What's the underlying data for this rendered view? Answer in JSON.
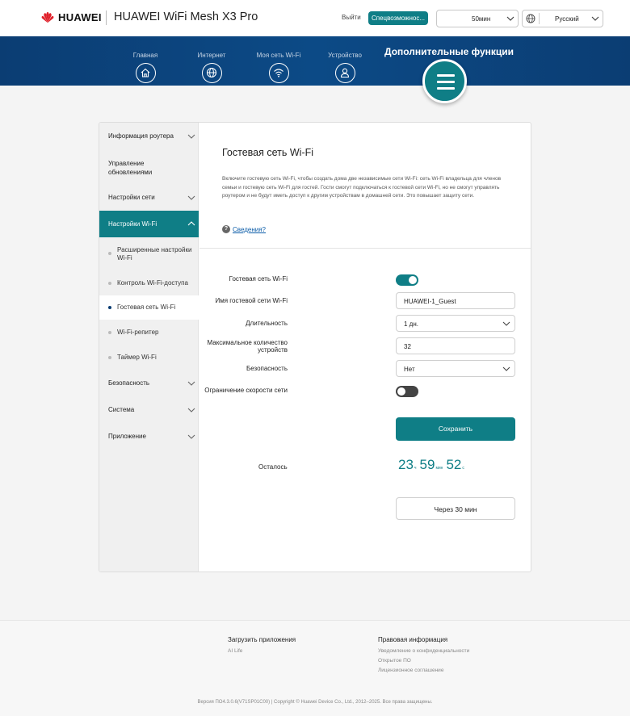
{
  "header": {
    "brand": "HUAWEI",
    "product": "HUAWEI WiFi Mesh X3 Pro",
    "logout": "Выйти",
    "special": "Спецвозможнос...",
    "timer_select": "50мин",
    "language_select": "Русский"
  },
  "nav": {
    "items": [
      {
        "label": "Главная",
        "icon": "home-icon"
      },
      {
        "label": "Интернет",
        "icon": "globe-icon"
      },
      {
        "label": "Моя сеть Wi-Fi",
        "icon": "wifi-icon"
      },
      {
        "label": "Устройство",
        "icon": "user-icon"
      }
    ],
    "extra": "Дополнительные функции"
  },
  "sidebar": {
    "items": [
      {
        "label": "Информация роутера"
      },
      {
        "label_line1": "Управление",
        "label_line2": "обновлениями"
      },
      {
        "label": "Настройки сети"
      },
      {
        "label": "Настройки Wi-Fi"
      },
      {
        "label": "Безопасность"
      },
      {
        "label": "Система"
      },
      {
        "label": "Приложение"
      }
    ],
    "sub_items": [
      {
        "label_line1": "Расширенные настройки",
        "label_line2": "Wi-Fi"
      },
      {
        "label": "Контроль Wi-Fi-доступа"
      },
      {
        "label": "Гостевая сеть Wi-Fi"
      },
      {
        "label": "Wi-Fi-репитер"
      },
      {
        "label": "Таймер Wi-Fi"
      }
    ]
  },
  "content": {
    "title": "Гостевая сеть Wi-Fi",
    "description": "Включите гостевую сеть Wi-Fi, чтобы создать дома две независимые сети Wi-Fi: сеть Wi-Fi владельца для членов семьи и гостевую сеть Wi-Fi для гостей. Гости смогут подключаться к гостевой сети Wi-Fi, но не смогут управлять роутером и не будут иметь доступ к другим устройствам в домашней сети. Это повышает защиту сети.",
    "help_mark": "?",
    "help": "Сведения?",
    "form": {
      "guest_wifi_label": "Гостевая сеть Wi-Fi",
      "guest_wifi_on": true,
      "ssid_label": "Имя гостевой сети Wi-Fi",
      "ssid_value": "HUAWEI-1_Guest",
      "duration_label": "Длительность",
      "duration_value": "1 дн.",
      "max_devices_label_line1": "Максимальное количество",
      "max_devices_label_line2": "устройств",
      "max_devices_value": "32",
      "security_label": "Безопасность",
      "security_value": "Нет",
      "speed_limit_label": "Ограничение скорости сети",
      "speed_limit_on": false
    },
    "save": "Сохранить",
    "remaining_label": "Осталось",
    "remaining": {
      "hours": "23",
      "hours_unit": "ч",
      "minutes": "59",
      "minutes_unit": "мин",
      "seconds": "52",
      "seconds_unit": "с"
    },
    "after_button": "Через 30 мин"
  },
  "footer": {
    "apps_title": "Загрузить приложения",
    "apps_link": "AI Life",
    "legal_title": "Правовая информация",
    "legal_links": [
      "Уведомление о конфиденциальности",
      "Открытое ПО",
      "Лицензионное соглашение"
    ],
    "copyright": "Версия ПО4.3.0.6(V71SP01C00) | Copyright © Huawei Device Co., Ltd., 2012–2025. Все права защищены."
  },
  "colors": {
    "accent": "#0f7e86",
    "nav": "#0b3d73",
    "brand_red": "#e0202a"
  }
}
